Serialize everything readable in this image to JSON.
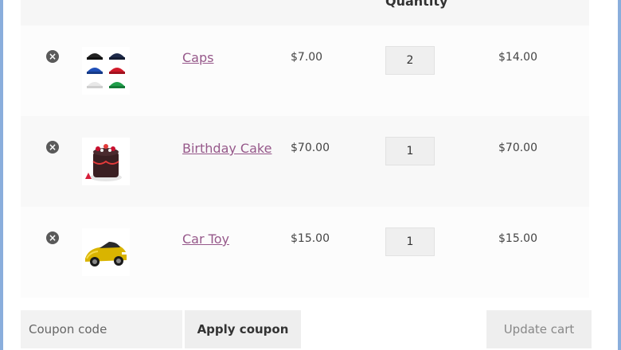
{
  "header": {
    "quantity_label": "Quantity"
  },
  "cart": {
    "items": [
      {
        "name": "Caps",
        "price": "$7.00",
        "quantity": "2",
        "subtotal": "$14.00",
        "remove_symbol": "×",
        "thumb_icon": "caps-image"
      },
      {
        "name": "Birthday Cake",
        "price": "$70.00",
        "quantity": "1",
        "subtotal": "$70.00",
        "remove_symbol": "×",
        "thumb_icon": "birthday-cake-image"
      },
      {
        "name": "Car Toy",
        "price": "$15.00",
        "quantity": "1",
        "subtotal": "$15.00",
        "remove_symbol": "×",
        "thumb_icon": "car-toy-image"
      }
    ]
  },
  "actions": {
    "coupon_placeholder": "Coupon code",
    "apply_label": "Apply coupon",
    "update_label": "Update cart"
  },
  "colors": {
    "link": "#96588a",
    "frame": "#8aaedc"
  }
}
